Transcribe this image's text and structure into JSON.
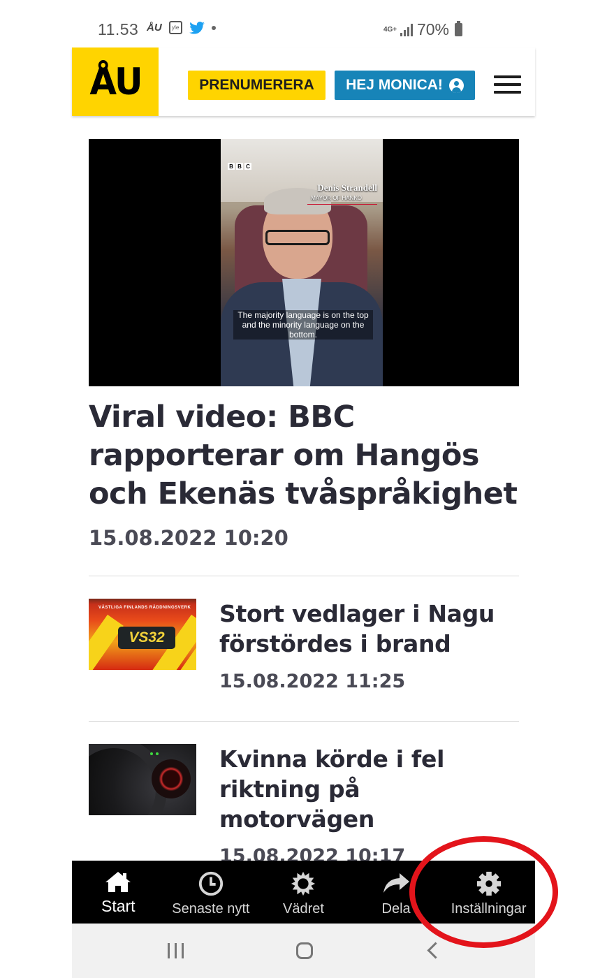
{
  "status_bar": {
    "time": "11.53",
    "app_badge": "ÅU",
    "yle_badge": "yle",
    "network": "4G+",
    "battery": "70%"
  },
  "header": {
    "logo_text": "ÅU",
    "subscribe_label": "PRENUMERERA",
    "greeting_label": "HEJ MONICA!",
    "menu_icon": "hamburger-menu-icon"
  },
  "hero": {
    "video": {
      "channel": [
        "B",
        "B",
        "C"
      ],
      "speaker_name": "Denis Strandell",
      "speaker_role": "MAYOR OF HANKO",
      "caption": "The majority language is on the top and the minority language on the bottom."
    },
    "title": "Viral video: BBC rapporterar om Hangös och Ekenäs tvåspråkighet",
    "date": "15.08.2022 10:20"
  },
  "articles": [
    {
      "thumb_label": "VS32",
      "thumb_topline": "VÄSTLIGA FINLANDS RÄDDNINGSVERK",
      "title": "Stort vedlager i Nagu förstördes i brand",
      "date": "15.08.2022 11:25"
    },
    {
      "title": "Kvinna körde i fel riktning på motorvägen",
      "date": "15.08.2022 10:17"
    }
  ],
  "bottom_nav": {
    "items": [
      {
        "label": "Start",
        "icon": "home-icon"
      },
      {
        "label": "Senaste nytt",
        "icon": "clock-icon"
      },
      {
        "label": "Vädret",
        "icon": "sun-icon"
      },
      {
        "label": "Dela",
        "icon": "share-arrow-icon"
      },
      {
        "label": "Inställningar",
        "icon": "gear-icon"
      }
    ]
  },
  "colors": {
    "brand_yellow": "#ffd400",
    "user_button_blue": "#1784b8",
    "annotation_red": "#e3141b",
    "nav_background": "#000000"
  }
}
